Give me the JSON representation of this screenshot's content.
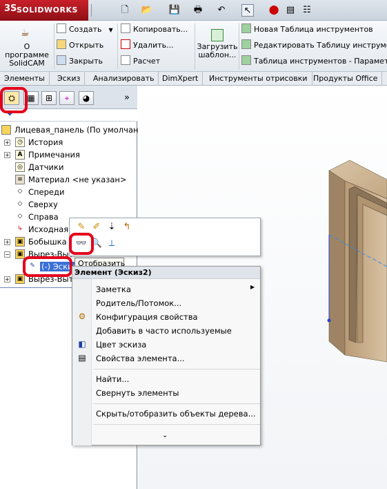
{
  "app": {
    "logo_mark": "3S",
    "logo_text": "SOLIDWORKS"
  },
  "ribbon": {
    "about": "О программе SolidCAM",
    "file_col": [
      "Создать",
      "Открыть",
      "Закрыть"
    ],
    "edit_col": [
      "Копировать...",
      "Удалить...",
      "Расчет"
    ],
    "load_templates": "Загрузить шаблон...",
    "tools_col": [
      "Новая Таблица инструментов",
      "Редактировать Таблицу инструмент",
      "Таблица инструментов - Параметры"
    ]
  },
  "tabs": [
    "Элементы",
    "Эскиз",
    "Анализировать",
    "DimXpert",
    "Инструменты отрисовки",
    "Продукты Office"
  ],
  "tree": {
    "root": "Лицевая_панель  (По умолчани",
    "items": [
      "История",
      "Примечания",
      "Датчики",
      "Материал <не указан>",
      "Спереди",
      "Сверху",
      "Справа",
      "Исходная т",
      "Бобышка",
      "Вырез-Выт",
      "(-) Эскиз",
      "Вырез-Выт"
    ]
  },
  "tooltip": "Отобразить",
  "context_menu": {
    "title": "Элемент (Эскиз2)",
    "items": [
      "Заметка",
      "Родитель/Потомок...",
      "Конфигурация свойства",
      "Добавить в часто используемые",
      "Цвет эскиза",
      "Свойства элемента...",
      "Найти...",
      "Свернуть элементы",
      "Скрыть/отобразить объекты дерева..."
    ],
    "expand": "⌄"
  },
  "colors": {
    "highlight": "#e3001b",
    "brand": "#c9202a",
    "wood": "#c9ad8a"
  }
}
